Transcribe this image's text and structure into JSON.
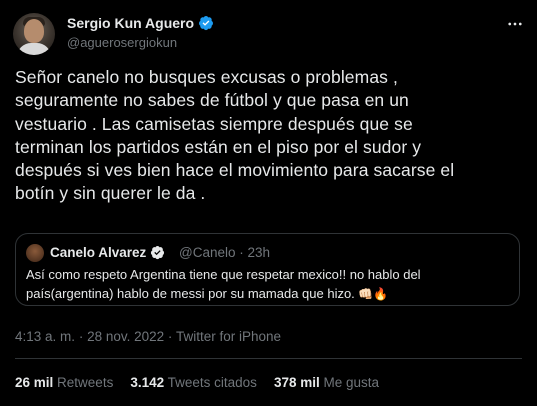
{
  "author": {
    "name": "Sergio Kun Aguero",
    "handle": "@aguerosergiokun"
  },
  "tweet": {
    "lines": [
      "Señor canelo no busques excusas o problemas ,",
      "seguramente no sabes de fútbol y que pasa en un",
      "vestuario . Las camisetas siempre después que se",
      "terminan los partidos  están en el piso por el sudor y",
      "después si ves bien hace el movimiento para sacarse el",
      "botín y sin querer le da ."
    ]
  },
  "quote": {
    "name": "Canelo Alvarez",
    "handle": "@Canelo",
    "separator": "·",
    "time": "23h",
    "lines": [
      "Así como respeto Argentina tiene que respetar mexico!! no hablo del",
      "país(argentina) hablo de messi por su mamada que hizo."
    ],
    "emojis": "👊🏻🔥"
  },
  "meta": {
    "time": "4:13 a. m.",
    "dot1": "·",
    "date": "28 nov. 2022",
    "dot2": "·",
    "source": "Twitter for iPhone"
  },
  "stats": {
    "retweets_count": "26 mil",
    "retweets_label": "Retweets",
    "quotes_count": "3.142",
    "quotes_label": "Tweets citados",
    "likes_count": "378 mil",
    "likes_label": "Me gusta"
  },
  "colors": {
    "background": "#000000",
    "text": "#e7e9ea",
    "secondary": "#71767b",
    "verified": "#1d9bf0",
    "border": "#2f3336"
  }
}
